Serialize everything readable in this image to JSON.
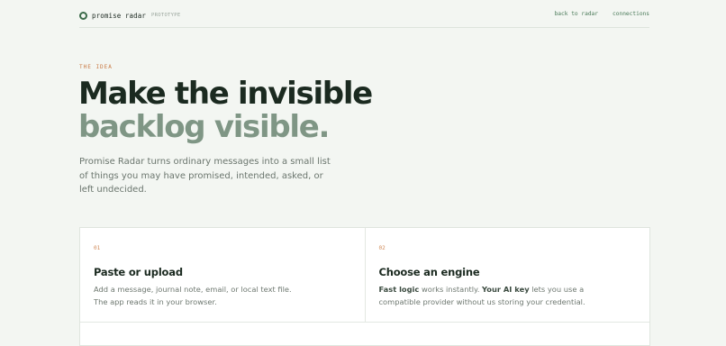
{
  "header": {
    "brand_name": "promise radar",
    "brand_tag": "PROTOTYPE",
    "nav": [
      "back to radar",
      "connections"
    ]
  },
  "hero": {
    "eyebrow": "THE IDEA",
    "headline_line1": "Make the invisible",
    "headline_line2": "backlog visible.",
    "intro": "Promise Radar turns ordinary messages into a small list of things you may have promised, intended, asked, or left undecided."
  },
  "steps": [
    {
      "number": "01",
      "title": "Paste or upload",
      "description": "Add a message, journal note, email, or local text file. The app reads it in your browser."
    },
    {
      "number": "02",
      "title": "Choose an engine",
      "description_bold_1": "Fast logic",
      "description_text_1": " works instantly. ",
      "description_bold_2": "Your AI key",
      "description_text_2": " lets you use a compatible provider without us storing your credential."
    }
  ],
  "colors": {
    "accent": "#3c6b4a",
    "eyebrow": "#c97a45",
    "background": "#f3f6f2"
  }
}
